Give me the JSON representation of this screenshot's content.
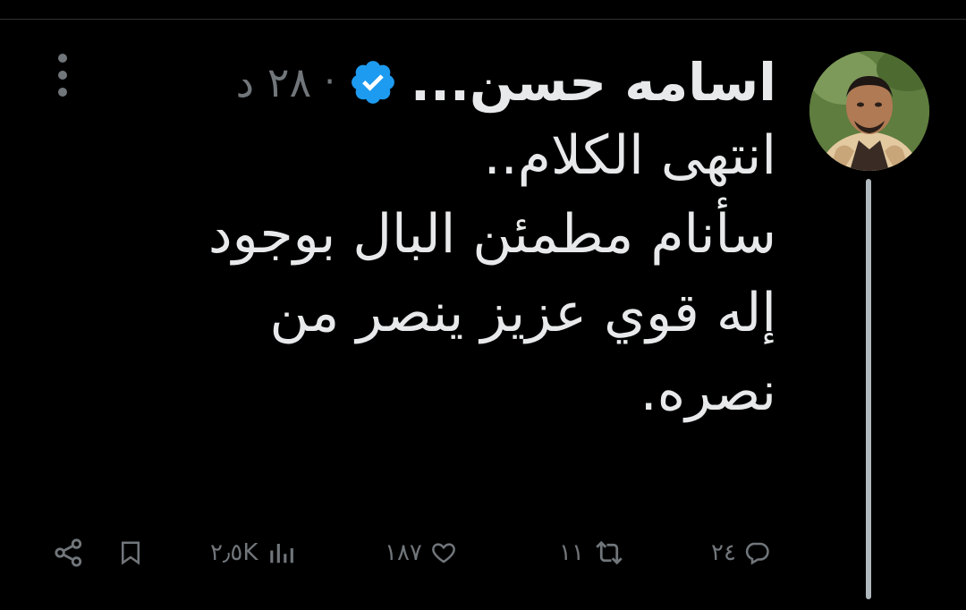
{
  "tweet": {
    "author_name": "اسامه حسن...",
    "separator": "·",
    "timestamp": "٢٨ د",
    "lines": [
      "انتهى الكلام..",
      "سأنام مطمئن البال بوجود",
      "إله قوي عزيز ينصر من",
      "نصره."
    ]
  },
  "actions": {
    "replies": "٢٤",
    "retweets": "١١",
    "likes": "١٨٧",
    "views": "٢٫٥K"
  },
  "colors": {
    "background": "#000000",
    "text": "#e7e9ea",
    "muted": "#71767b",
    "verified": "#1d9bf0"
  },
  "icons": {
    "verified": "verified-badge-icon",
    "more": "more-dots-icon",
    "reply": "reply-icon",
    "retweet": "retweet-icon",
    "like": "heart-icon",
    "views": "views-chart-icon",
    "bookmark": "bookmark-icon",
    "share": "share-icon"
  }
}
